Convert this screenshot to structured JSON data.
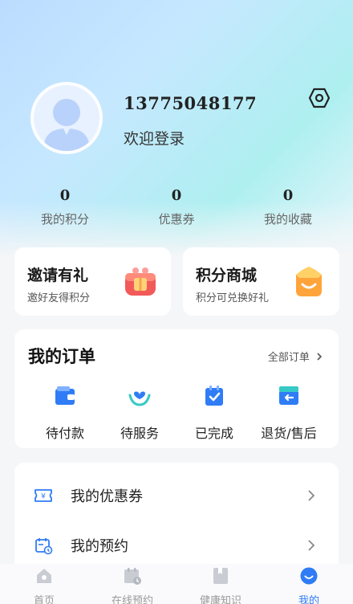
{
  "profile": {
    "phone": "13775048177",
    "welcome": "欢迎登录"
  },
  "stats": [
    {
      "value": "0",
      "label": "我的积分"
    },
    {
      "value": "0",
      "label": "优惠券"
    },
    {
      "value": "0",
      "label": "我的收藏"
    }
  ],
  "promos": [
    {
      "title": "邀请有礼",
      "subtitle": "邀好友得积分",
      "icon": "gift-icon"
    },
    {
      "title": "积分商城",
      "subtitle": "积分可兑换好礼",
      "icon": "crown-smile-icon"
    }
  ],
  "orders": {
    "title": "我的订单",
    "all_label": "全部订单",
    "items": [
      {
        "label": "待付款",
        "icon": "wallet-icon"
      },
      {
        "label": "待服务",
        "icon": "service-heart-icon"
      },
      {
        "label": "已完成",
        "icon": "completed-check-icon"
      },
      {
        "label": "退货/售后",
        "icon": "return-icon"
      }
    ]
  },
  "menu": [
    {
      "label": "我的优惠券",
      "icon": "coupon-icon"
    },
    {
      "label": "我的预约",
      "icon": "calendar-icon"
    }
  ],
  "tabs": [
    {
      "label": "首页",
      "icon": "home-icon"
    },
    {
      "label": "在线预约",
      "icon": "appointment-icon"
    },
    {
      "label": "健康知识",
      "icon": "book-icon"
    },
    {
      "label": "我的",
      "icon": "profile-smile-icon",
      "active": true
    }
  ],
  "colors": {
    "accent": "#2f7cf6",
    "teal": "#36c9c6",
    "promo_red": "#f25a5a",
    "promo_orange": "#ffa43a"
  }
}
